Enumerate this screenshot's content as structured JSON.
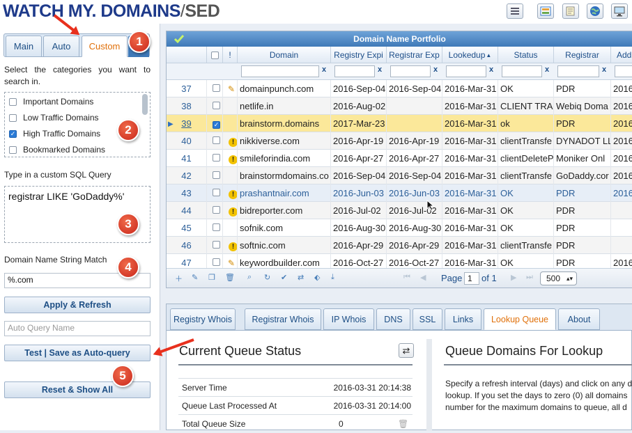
{
  "logo": {
    "part1": "WATCH MY. DOMAINS",
    "sep": "/",
    "part2": "SED"
  },
  "toolbar_icons": [
    "menu-icon",
    "grid-view-icon",
    "notes-icon",
    "globe-icon",
    "monitor-icon"
  ],
  "left_panel": {
    "tabs": [
      {
        "label": "Main"
      },
      {
        "label": "Auto"
      },
      {
        "label": "Custom",
        "active": true
      }
    ],
    "categories_label": "Select the categories you want to search in.",
    "categories": [
      {
        "label": "Important Domains",
        "checked": false
      },
      {
        "label": "Low Traffic Domains",
        "checked": false
      },
      {
        "label": "High Traffic Domains",
        "checked": true
      },
      {
        "label": "Bookmarked Domains",
        "checked": false
      }
    ],
    "sql_label": "Type in a custom SQL Query",
    "sql_value": "registrar LIKE 'GoDaddy%'",
    "string_match_label": "Domain Name String Match",
    "string_match_value": "%.com",
    "apply_button": "Apply & Refresh",
    "auto_query_placeholder": "Auto Query Name",
    "save_button": "Test | Save as Auto-query",
    "reset_button": "Reset & Show All"
  },
  "badges": [
    "1",
    "2",
    "3",
    "4",
    "5"
  ],
  "grid": {
    "title": "Domain Name Portfolio",
    "columns": [
      "!",
      "Domain",
      "Registry Expi",
      "Registrar Exp",
      "Lookedup",
      "Status",
      "Registrar",
      "Add"
    ],
    "filter_clear": "x",
    "rows": [
      {
        "n": "37",
        "mark": "edit",
        "domain": "domainpunch.com",
        "reg_exp": "2016-Sep-04",
        "rar_exp": "2016-Sep-04",
        "lookedup": "2016-Mar-31",
        "status": "OK",
        "registrar": "PDR",
        "add": "2016"
      },
      {
        "n": "38",
        "mark": "",
        "domain": "netlife.in",
        "reg_exp": "2016-Aug-02",
        "rar_exp": "",
        "lookedup": "2016-Mar-31",
        "status": "CLIENT TRAN",
        "registrar": "Webiq Doma",
        "add": "2016"
      },
      {
        "n": "39",
        "mark": "",
        "domain": "brainstorm.domains",
        "reg_exp": "2017-Mar-23",
        "rar_exp": "",
        "lookedup": "2016-Mar-31",
        "status": "ok",
        "registrar": "PDR",
        "add": "2016",
        "selected": true
      },
      {
        "n": "40",
        "mark": "warn",
        "domain": "nikkiverse.com",
        "reg_exp": "2016-Apr-19",
        "rar_exp": "2016-Apr-19",
        "lookedup": "2016-Mar-31",
        "status": "clientTransfe",
        "registrar": "DYNADOT LL",
        "add": "2016"
      },
      {
        "n": "41",
        "mark": "warn",
        "domain": "smileforindia.com",
        "reg_exp": "2016-Apr-27",
        "rar_exp": "2016-Apr-27",
        "lookedup": "2016-Mar-31",
        "status": "clientDeleteP",
        "registrar": "Moniker Onl",
        "add": "2016"
      },
      {
        "n": "42",
        "mark": "",
        "domain": "brainstormdomains.co",
        "reg_exp": "2016-Sep-04",
        "rar_exp": "2016-Sep-04",
        "lookedup": "2016-Mar-31",
        "status": "clientTransfe",
        "registrar": "GoDaddy.cor",
        "add": "2016"
      },
      {
        "n": "43",
        "mark": "warn",
        "domain": "prashantnair.com",
        "reg_exp": "2016-Jun-03",
        "rar_exp": "2016-Jun-03",
        "lookedup": "2016-Mar-31",
        "status": "OK",
        "registrar": "PDR",
        "add": "2016",
        "hover": true
      },
      {
        "n": "44",
        "mark": "warn",
        "domain": "bidreporter.com",
        "reg_exp": "2016-Jul-02",
        "rar_exp": "2016-Jul-02",
        "lookedup": "2016-Mar-31",
        "status": "OK",
        "registrar": "PDR",
        "add": ""
      },
      {
        "n": "45",
        "mark": "",
        "domain": "sofnik.com",
        "reg_exp": "2016-Aug-30",
        "rar_exp": "2016-Aug-30",
        "lookedup": "2016-Mar-31",
        "status": "OK",
        "registrar": "PDR",
        "add": ""
      },
      {
        "n": "46",
        "mark": "warn",
        "domain": "softnic.com",
        "reg_exp": "2016-Apr-29",
        "rar_exp": "2016-Apr-29",
        "lookedup": "2016-Mar-31",
        "status": "clientTransfe",
        "registrar": "PDR",
        "add": ""
      },
      {
        "n": "47",
        "mark": "edit",
        "domain": "keywordbuilder.com",
        "reg_exp": "2016-Oct-27",
        "rar_exp": "2016-Oct-27",
        "lookedup": "2016-Mar-31",
        "status": "OK",
        "registrar": "PDR",
        "add": "2016"
      }
    ],
    "footer": {
      "page_label": "Page",
      "page_value": "1",
      "of_label": "of 1",
      "page_size": "500"
    }
  },
  "bottom": {
    "tabs": [
      {
        "label": "Registry Whois"
      },
      {
        "label": "Registrar Whois"
      },
      {
        "label": "IP Whois"
      },
      {
        "label": "DNS"
      },
      {
        "label": "SSL"
      },
      {
        "label": "Links"
      },
      {
        "label": "Lookup Queue",
        "active": true
      },
      {
        "label": "About"
      }
    ],
    "queue_title": "Current Queue Status",
    "queue_rows": [
      {
        "label": "Server Time",
        "value": "2016-03-31 20:14:38"
      },
      {
        "label": "Queue Last Processed At",
        "value": "2016-03-31 20:14:00"
      },
      {
        "label": "Total Queue Size",
        "value": "0"
      }
    ],
    "queue_domains_title": "Queue Domains For Lookup",
    "queue_domains_text": [
      "Specify a refresh interval (days) and click on any d",
      "lookup. If you set the days to zero (0) all domains",
      "number for the maximum domains to queue, all d"
    ]
  }
}
